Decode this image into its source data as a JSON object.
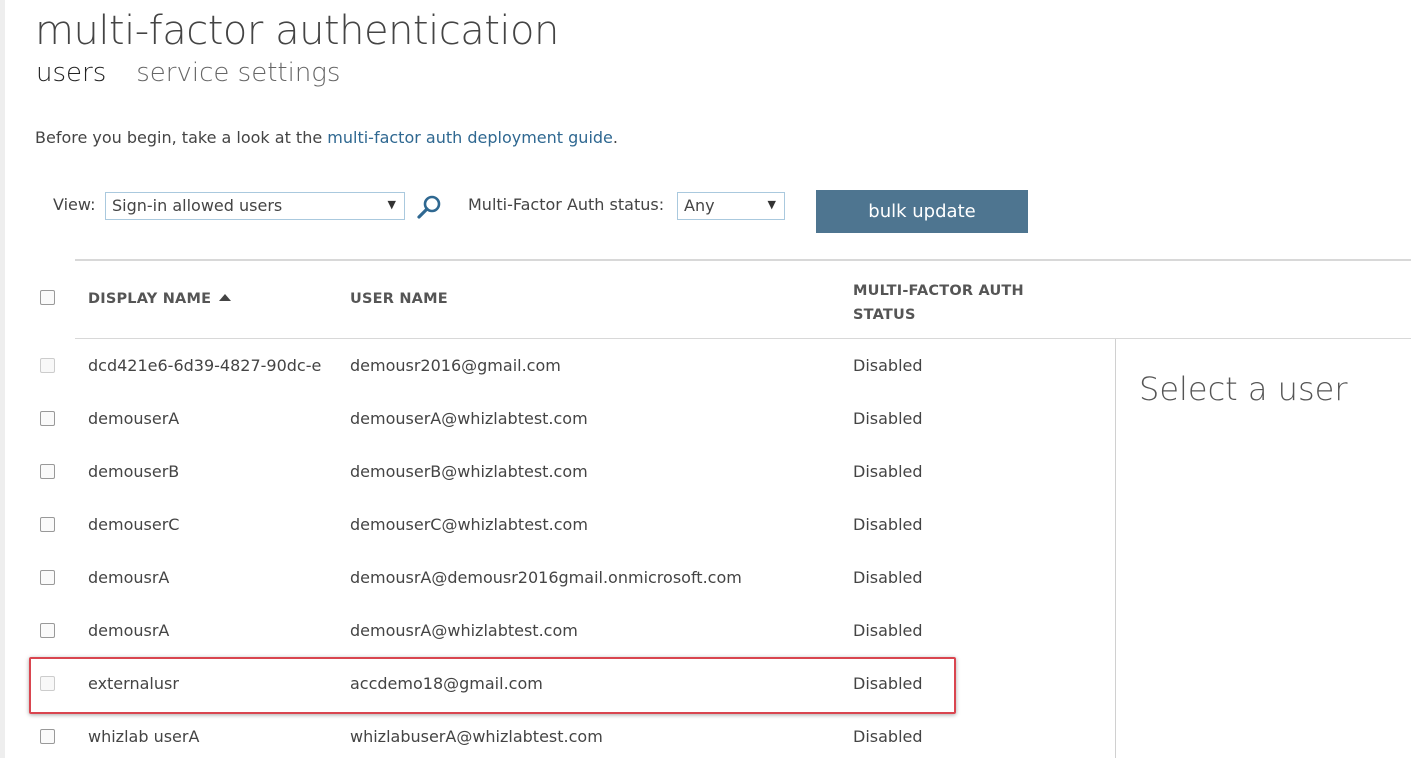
{
  "page": {
    "title": "multi-factor authentication"
  },
  "tabs": [
    {
      "label": "users",
      "active": true
    },
    {
      "label": "service settings",
      "active": false
    }
  ],
  "intro": {
    "prefix": "Before you begin, take a look at the ",
    "link": "multi-factor auth deployment guide",
    "suffix": "."
  },
  "filters": {
    "view_label": "View:",
    "view_value": "Sign-in allowed users",
    "status_label": "Multi-Factor Auth status:",
    "status_value": "Any",
    "search_icon": "magnifier-icon",
    "bulk_update_label": "bulk update"
  },
  "table": {
    "columns": {
      "display_name": "DISPLAY NAME",
      "user_name": "USER NAME",
      "mfa_status_line1": "MULTI-FACTOR AUTH",
      "mfa_status_line2": "STATUS"
    },
    "sort": {
      "column": "display_name",
      "direction": "ascending"
    },
    "rows": [
      {
        "display_name": "dcd421e6-6d39-4827-90dc-e",
        "user_name": "demousr2016@gmail.com",
        "status": "Disabled",
        "checkbox_enabled": false
      },
      {
        "display_name": "demouserA",
        "user_name": "demouserA@whizlabtest.com",
        "status": "Disabled",
        "checkbox_enabled": true
      },
      {
        "display_name": "demouserB",
        "user_name": "demouserB@whizlabtest.com",
        "status": "Disabled",
        "checkbox_enabled": true
      },
      {
        "display_name": "demouserC",
        "user_name": "demouserC@whizlabtest.com",
        "status": "Disabled",
        "checkbox_enabled": true
      },
      {
        "display_name": "demousrA",
        "user_name": "demousrA@demousr2016gmail.onmicrosoft.com",
        "status": "Disabled",
        "checkbox_enabled": true
      },
      {
        "display_name": "demousrA",
        "user_name": "demousrA@whizlabtest.com",
        "status": "Disabled",
        "checkbox_enabled": true
      },
      {
        "display_name": "externalusr",
        "user_name": "accdemo18@gmail.com",
        "status": "Disabled",
        "checkbox_enabled": false
      },
      {
        "display_name": "whizlab userA",
        "user_name": "whizlabuserA@whizlabtest.com",
        "status": "Disabled",
        "checkbox_enabled": true
      }
    ]
  },
  "detail_panel": {
    "placeholder": "Select a user"
  },
  "colors": {
    "accent_button": "#4e7590",
    "link": "#2f6891",
    "highlight_border": "#d9454f"
  }
}
